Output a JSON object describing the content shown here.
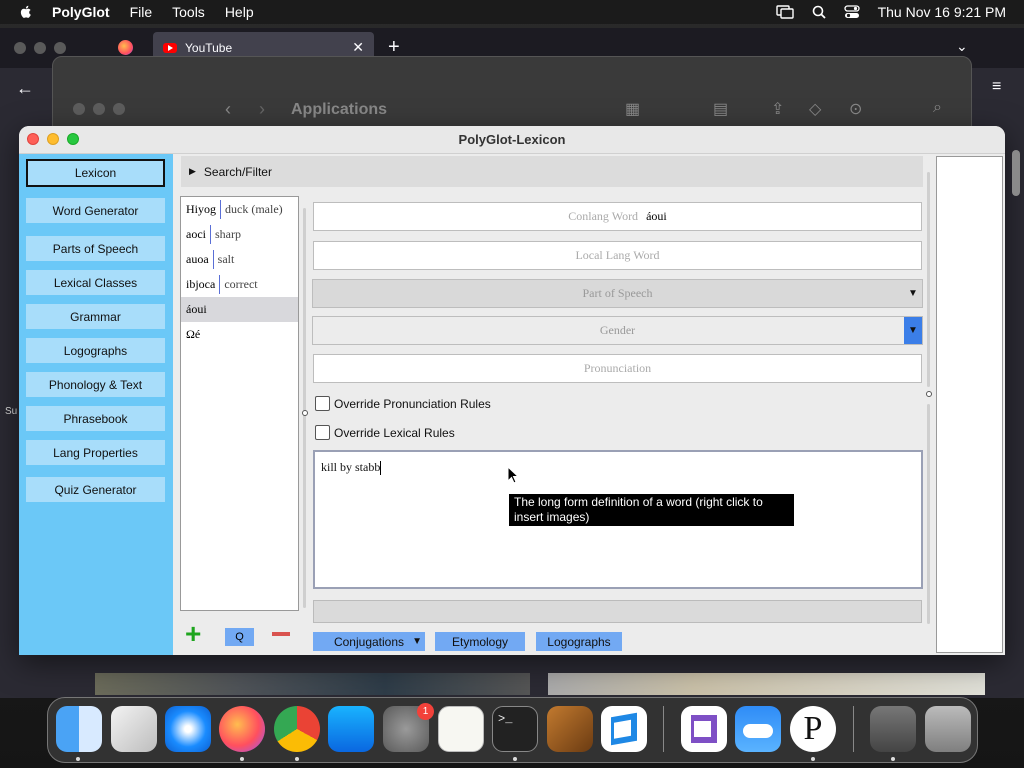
{
  "menubar": {
    "app_name": "PolyGlot",
    "items": [
      "File",
      "Tools",
      "Help"
    ],
    "datetime": "Thu Nov 16  9:21 PM"
  },
  "browser": {
    "tab_title": "YouTube"
  },
  "finder": {
    "title": "Applications"
  },
  "window": {
    "title": "PolyGlot-Lexicon"
  },
  "sidebar": {
    "items": [
      {
        "label": "Lexicon",
        "active": true
      },
      {
        "label": "Word Generator"
      },
      {
        "label": "Parts of Speech"
      },
      {
        "label": "Lexical Classes"
      },
      {
        "label": "Grammar"
      },
      {
        "label": "Logographs"
      },
      {
        "label": "Phonology & Text"
      },
      {
        "label": "Phrasebook"
      },
      {
        "label": "Lang Properties"
      },
      {
        "label": "Quiz Generator"
      }
    ]
  },
  "search": {
    "label": "Search/Filter"
  },
  "wordlist": [
    {
      "con": "Hiyog",
      "local": "duck (male)"
    },
    {
      "con": "aoci",
      "local": "sharp"
    },
    {
      "con": "auoa",
      "local": "salt"
    },
    {
      "con": "ibjoca",
      "local": "correct"
    },
    {
      "con": "áoui",
      "local": "",
      "selected": true
    },
    {
      "con": "Ωé",
      "local": ""
    }
  ],
  "fields": {
    "conlang_label": "Conlang Word",
    "conlang_value": "áoui",
    "local_placeholder": "Local Lang Word",
    "pos_placeholder": "Part of Speech",
    "gender_placeholder": "Gender",
    "pronunciation_placeholder": "Pronunciation",
    "override_pron": "Override Pronunciation Rules",
    "override_lex": "Override Lexical Rules",
    "definition": "kill by stabb",
    "tooltip": "The long form definition of a word (right click to insert images)"
  },
  "buttons": {
    "add": "+",
    "filter": "Q",
    "delete": "−",
    "conjugations": "Conjugations",
    "etymology": "Etymology",
    "logographs": "Logographs"
  },
  "dock": {
    "apps": [
      "Finder",
      "Launchpad",
      "Safari",
      "Firefox",
      "Chrome",
      "App Store",
      "System Settings",
      "TextEdit",
      "Terminal",
      "GarageBand",
      "VS Code",
      "Visual Studio",
      "Weather",
      "PolyGlot",
      "Preview",
      "Trash"
    ],
    "settings_badge": "1"
  },
  "colors": {
    "sidebar": "#6bc8f7",
    "sidebar_button": "#a8ddfa",
    "action_button": "#72a9f3"
  }
}
